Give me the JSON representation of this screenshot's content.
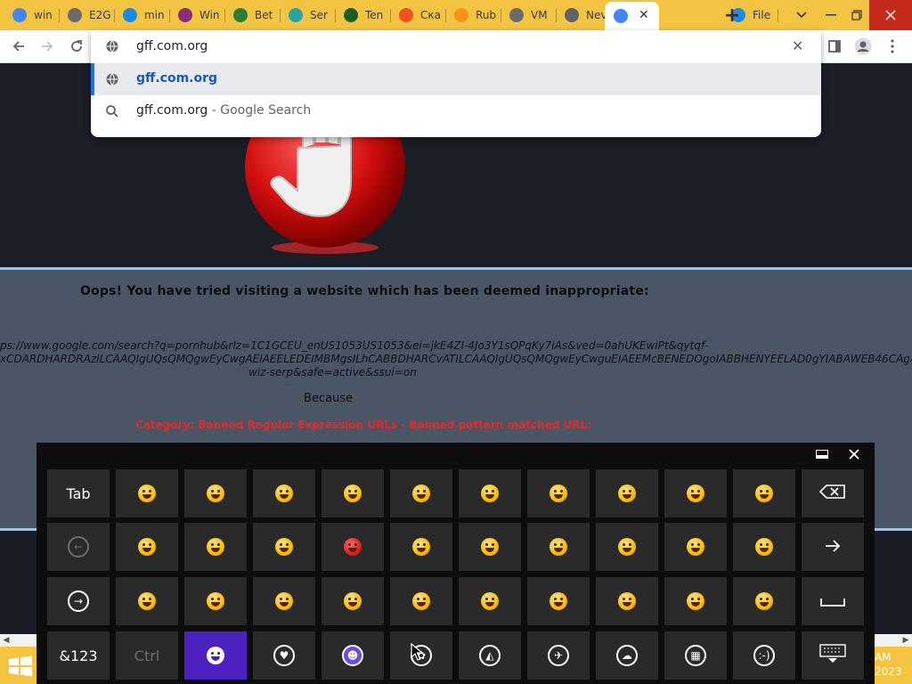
{
  "tabs": [
    {
      "label": "win",
      "icon": "google-icon",
      "color": "#4285f4"
    },
    {
      "label": "E2G",
      "icon": "globe-icon",
      "color": "#6b6b6b"
    },
    {
      "label": "min",
      "icon": "cloud-icon",
      "color": "#1e88e5"
    },
    {
      "label": "Win",
      "icon": "winrar-icon",
      "color": "#8e2b7a"
    },
    {
      "label": "Bet",
      "icon": "earth-icon",
      "color": "#2e7d32"
    },
    {
      "label": "Ser",
      "icon": "grid-icon",
      "color": "#2aa3a3"
    },
    {
      "label": "Ten",
      "icon": "c-logo-icon",
      "color": "#1b5e20"
    },
    {
      "label": "Ска",
      "icon": "microsoft-icon",
      "color": "#f25022"
    },
    {
      "label": "Rub",
      "icon": "bitcoin-icon",
      "color": "#f7931a"
    },
    {
      "label": "VM",
      "icon": "globe-icon",
      "color": "#6b6b6b"
    },
    {
      "label": "Nev",
      "icon": "chrome-icon",
      "color": "#5f6368"
    },
    {
      "label": "",
      "icon": "google-icon",
      "color": "#4285f4",
      "active": true
    },
    {
      "label": "File",
      "icon": "cloud-icon",
      "color": "#1e88e5"
    }
  ],
  "omnibox": {
    "value": "gff.com.org",
    "suggestions": [
      {
        "url": "gff.com.org",
        "sub": ""
      },
      {
        "url": "gff.com.org",
        "sub": " - Google Search"
      }
    ]
  },
  "page": {
    "heading": "Oops! You have tried visiting a website which has been deemed inappropriate:",
    "url_lines": [
      "ps://www.google.com/search?q=pornhub&rlz=1C1GCEU_enUS1053US1053&ei=jkE4ZI-4Jo3Y1sQPqKy7iAs&ved=0ahUKEwiPt&qytqf-",
      "xCDARDHARDRAzILCAAQIgUQsQMQgwEyCwgAEIAEELEDEIMBMgsILhCABBDHARCvATILCAAQIgUQsQMQgwEyCwguEIAEEMcBENEDOgoIABBHENYEELAD0gYIABAWEB46CAgAEIoFEIYDOgUIl",
      "wiz-serp&safe=active&ssui=on"
    ],
    "because": "Because",
    "category": "Category: Banned Regular Expression URLs - Banned pattern matched URL:"
  },
  "keyboard": {
    "row1": {
      "left": "Tab",
      "emojis": [
        "grin",
        "wink",
        "laugh",
        "halo",
        "dizzy",
        "smirk",
        "sweat",
        "flushed",
        "tongue",
        "worried"
      ],
      "right": "backspace-icon"
    },
    "row2": {
      "left": "back-arrow-icon",
      "emojis": [
        "smile",
        "grimace",
        "joy",
        "devil",
        "heart-eyes",
        "neutral",
        "expressionless",
        "astonished",
        "tired",
        "unamused"
      ],
      "right": "right-arrow-icon"
    },
    "row3": {
      "left": "next-icon",
      "emojis": [
        "frown",
        "tears-of-joy",
        "grin-big",
        "yum",
        "sunglasses",
        "squint",
        "smile-small",
        "tongue-wink",
        "sad",
        "open-mouth"
      ],
      "right": "space-icon"
    },
    "row4": {
      "left": "&123",
      "ctrl": "Ctrl",
      "icons": [
        "smiley-icon",
        "heart-icon",
        "people-icon",
        "flower-icon",
        "pizza-icon",
        "airplane-icon",
        "weather-icon",
        "symbols-icon",
        "emoticon-icon"
      ],
      "right": "keyboard-icon"
    }
  },
  "taskbar": {
    "time": "AM",
    "year": "2023"
  },
  "colors": {
    "chrome_frame": "#f3c441",
    "accent": "#1a73e8",
    "banned_text": "#e42a2a",
    "emoji_active": "#4b22c0"
  }
}
